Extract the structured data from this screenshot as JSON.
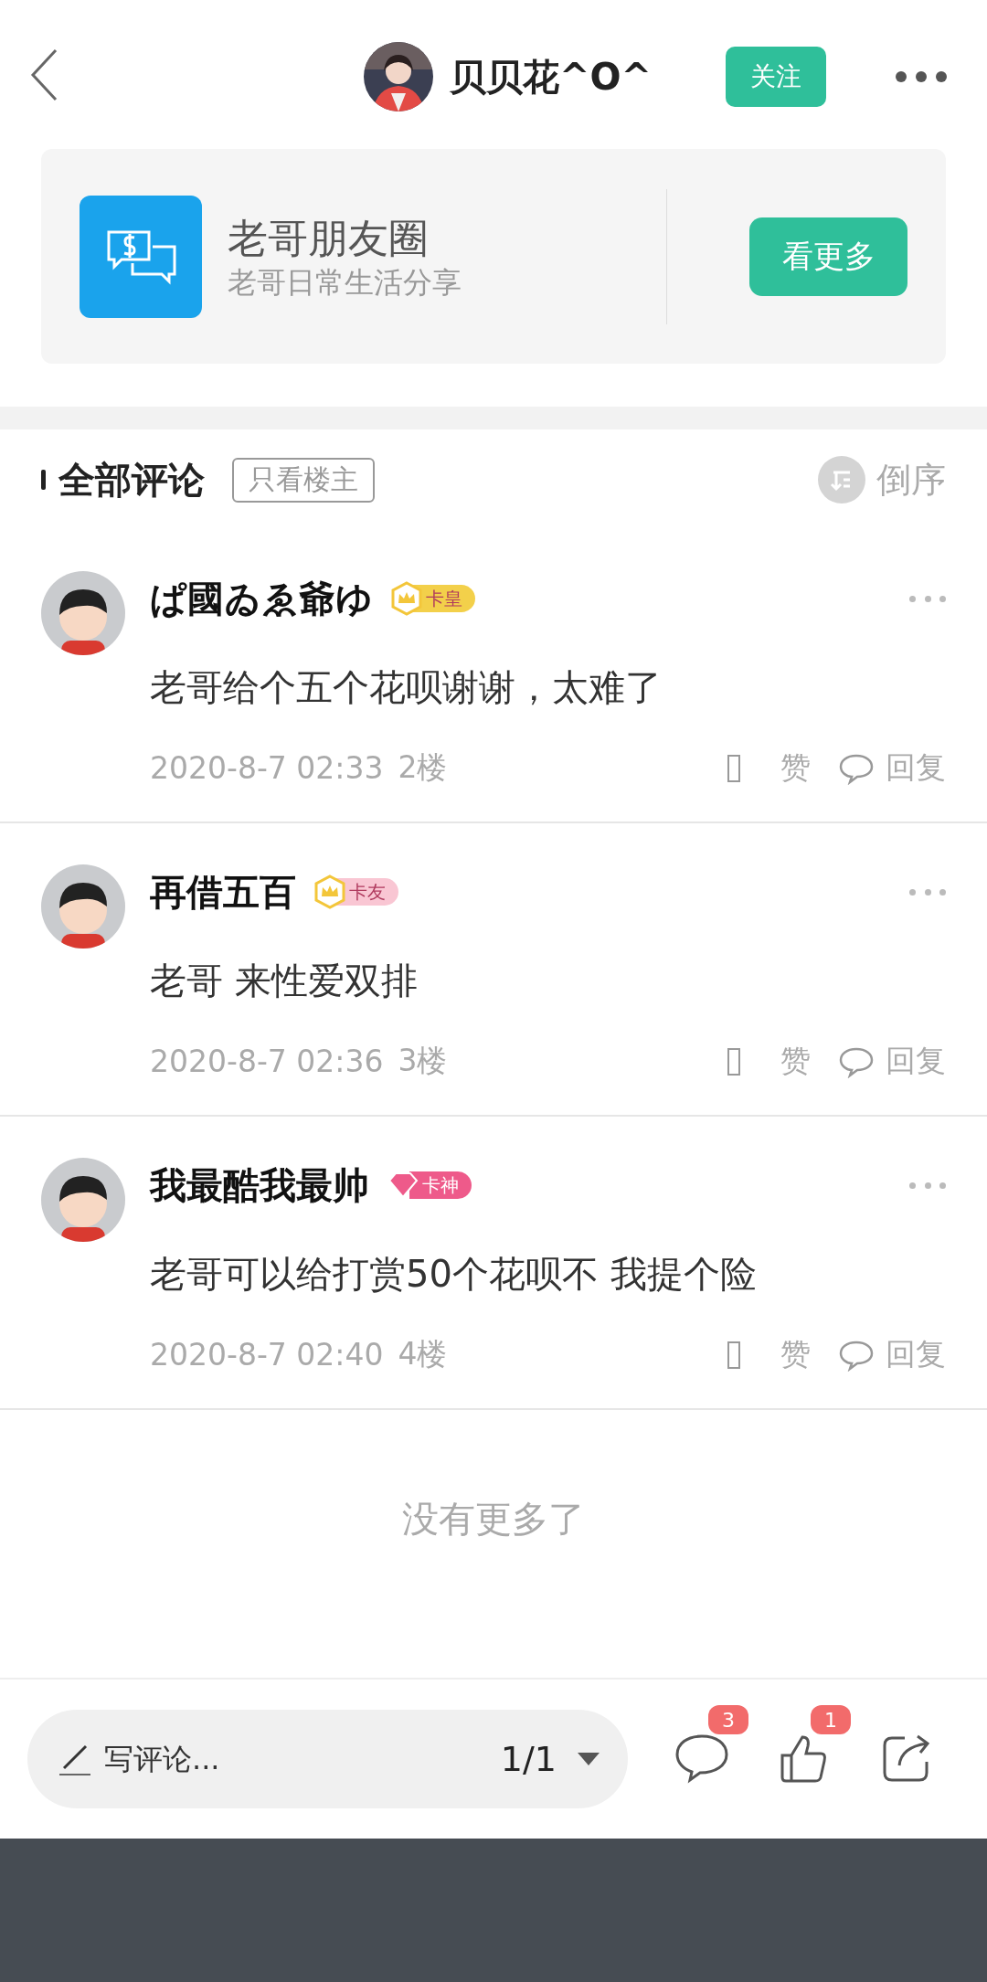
{
  "header": {
    "username": "贝贝花^O^",
    "follow_button": "关注"
  },
  "card": {
    "title": "老哥朋友圈",
    "subtitle": "老哥日常生活分享",
    "button": "看更多"
  },
  "comments_header": {
    "title": "全部评论",
    "filter": "只看楼主",
    "sort": "倒序"
  },
  "comments": [
    {
      "name": "ぱ國ゐゑ爺ゆ",
      "badge": {
        "label": "卡皇",
        "kind": "crown",
        "color": "#f3d04a"
      },
      "text": "老哥给个五个花呗谢谢，太难了",
      "time": "2020-8-7 02:33",
      "floor": "2楼",
      "like": "赞",
      "reply": "回复"
    },
    {
      "name": "再借五百",
      "badge": {
        "label": "卡友",
        "kind": "crown",
        "color": "#f9c6d3"
      },
      "text": "老哥 来性爱双排",
      "time": "2020-8-7 02:36",
      "floor": "3楼",
      "like": "赞",
      "reply": "回复"
    },
    {
      "name": "我最酷我最帅",
      "badge": {
        "label": "卡神",
        "kind": "diamond",
        "color": "#ee5a8a"
      },
      "text": "老哥可以给打赏50个花呗不 我提个险",
      "time": "2020-8-7 02:40",
      "floor": "4楼",
      "like": "赞",
      "reply": "回复"
    }
  ],
  "end_note": "没有更多了",
  "bottom_bar": {
    "placeholder": "写评论...",
    "page": "1/1",
    "comment_count": "3",
    "like_count": "1"
  }
}
